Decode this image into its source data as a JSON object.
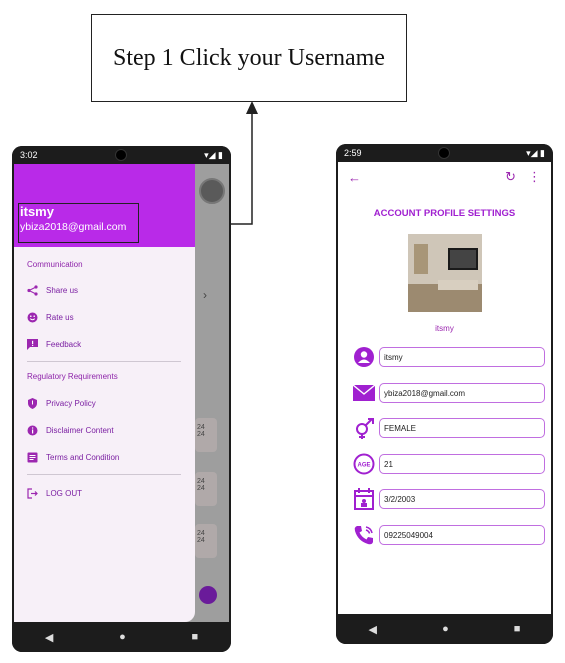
{
  "callout": {
    "text": "Step 1 Click your Username"
  },
  "left_phone": {
    "status_time": "3:02",
    "username": "itsmy",
    "email": "ybiza2018@gmail.com",
    "sections": {
      "communication": "Communication",
      "regulatory": "Regulatory Requirements"
    },
    "items": {
      "share": "Share us",
      "rate": "Rate us",
      "feedback": "Feedback",
      "privacy": "Privacy Policy",
      "disclaimer": "Disclaimer Content",
      "terms": "Terms and Condition",
      "logout": "LOG OUT"
    },
    "background_fragments": {
      "chevron": "›",
      "r1a": "24",
      "r1b": "24",
      "r2a": "24",
      "r2b": "24",
      "r3a": "24",
      "r3b": "24"
    }
  },
  "right_phone": {
    "status_time": "2:59",
    "title": "ACCOUNT PROFILE SETTINGS",
    "profile_name": "itsmy",
    "fields": {
      "username": "itsmy",
      "email": "ybiza2018@gmail.com",
      "gender": "FEMALE",
      "age": "21",
      "birthdate": "3/2/2003",
      "phone": "09225049004"
    },
    "age_icon_text": "AGE"
  },
  "nav": {
    "back": "◀",
    "home": "●",
    "recents": "■"
  },
  "colors": {
    "accent": "#9c27b0",
    "drawer_header": "#b92ae8",
    "field_border": "#c06ee0"
  }
}
